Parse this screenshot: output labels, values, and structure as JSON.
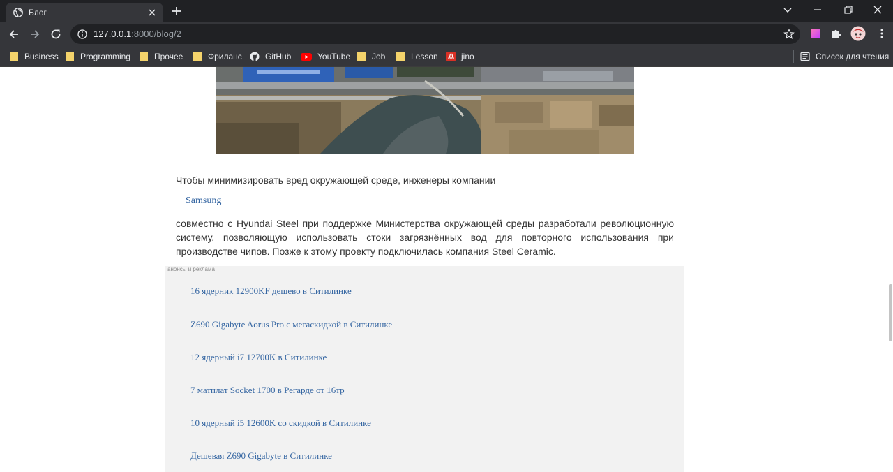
{
  "browser": {
    "tab_title": "Блог",
    "url_host": "127.0.0.1",
    "url_rest": ":8000/blog/2",
    "bookmarks": [
      {
        "label": "Business",
        "icon": "folder-icon"
      },
      {
        "label": "Programming",
        "icon": "folder-icon"
      },
      {
        "label": "Прочее",
        "icon": "folder-icon"
      },
      {
        "label": "Фриланс",
        "icon": "folder-icon"
      },
      {
        "label": "GitHub",
        "icon": "github-icon"
      },
      {
        "label": "YouTube",
        "icon": "youtube-icon"
      },
      {
        "label": "Job",
        "icon": "folder-icon"
      },
      {
        "label": "Lesson",
        "icon": "folder-icon"
      },
      {
        "label": "jino",
        "icon": "jino-icon"
      }
    ],
    "reading_list": "Список для чтения"
  },
  "article": {
    "para1": "Чтобы минимизировать вред окружающей среде, инженеры компании",
    "samsung_link": "Samsung",
    "para2": " совместно с Hyundai Steel при поддержке Министерства окружающей среды разработали революционную систему, позволяющую использовать стоки загрязнённых вод для повторного использования при производстве чипов. Позже к этому проекту подключилась компания Steel Ceramic."
  },
  "ads": {
    "label": "анонсы и реклама",
    "links": [
      "16 ядерник 12900KF дешево в Ситилинке",
      "Z690 Gigabyte Aorus Pro с мегаскидкой в Ситилинке",
      "12 ядерный i7 12700K в Ситилинке",
      "7 матплат Socket 1700 в Регарде от 16тр",
      "10 ядерный i5 12600K со скидкой в Ситилинке",
      "Дешевая Z690 Gigabyte в Ситилинке"
    ]
  },
  "colors": {
    "tabbar_bg": "#202124",
    "toolbar_bg": "#35363a",
    "link": "#3566a2",
    "ads_bg": "#f2f2f2",
    "folder": "#f4d36b"
  }
}
